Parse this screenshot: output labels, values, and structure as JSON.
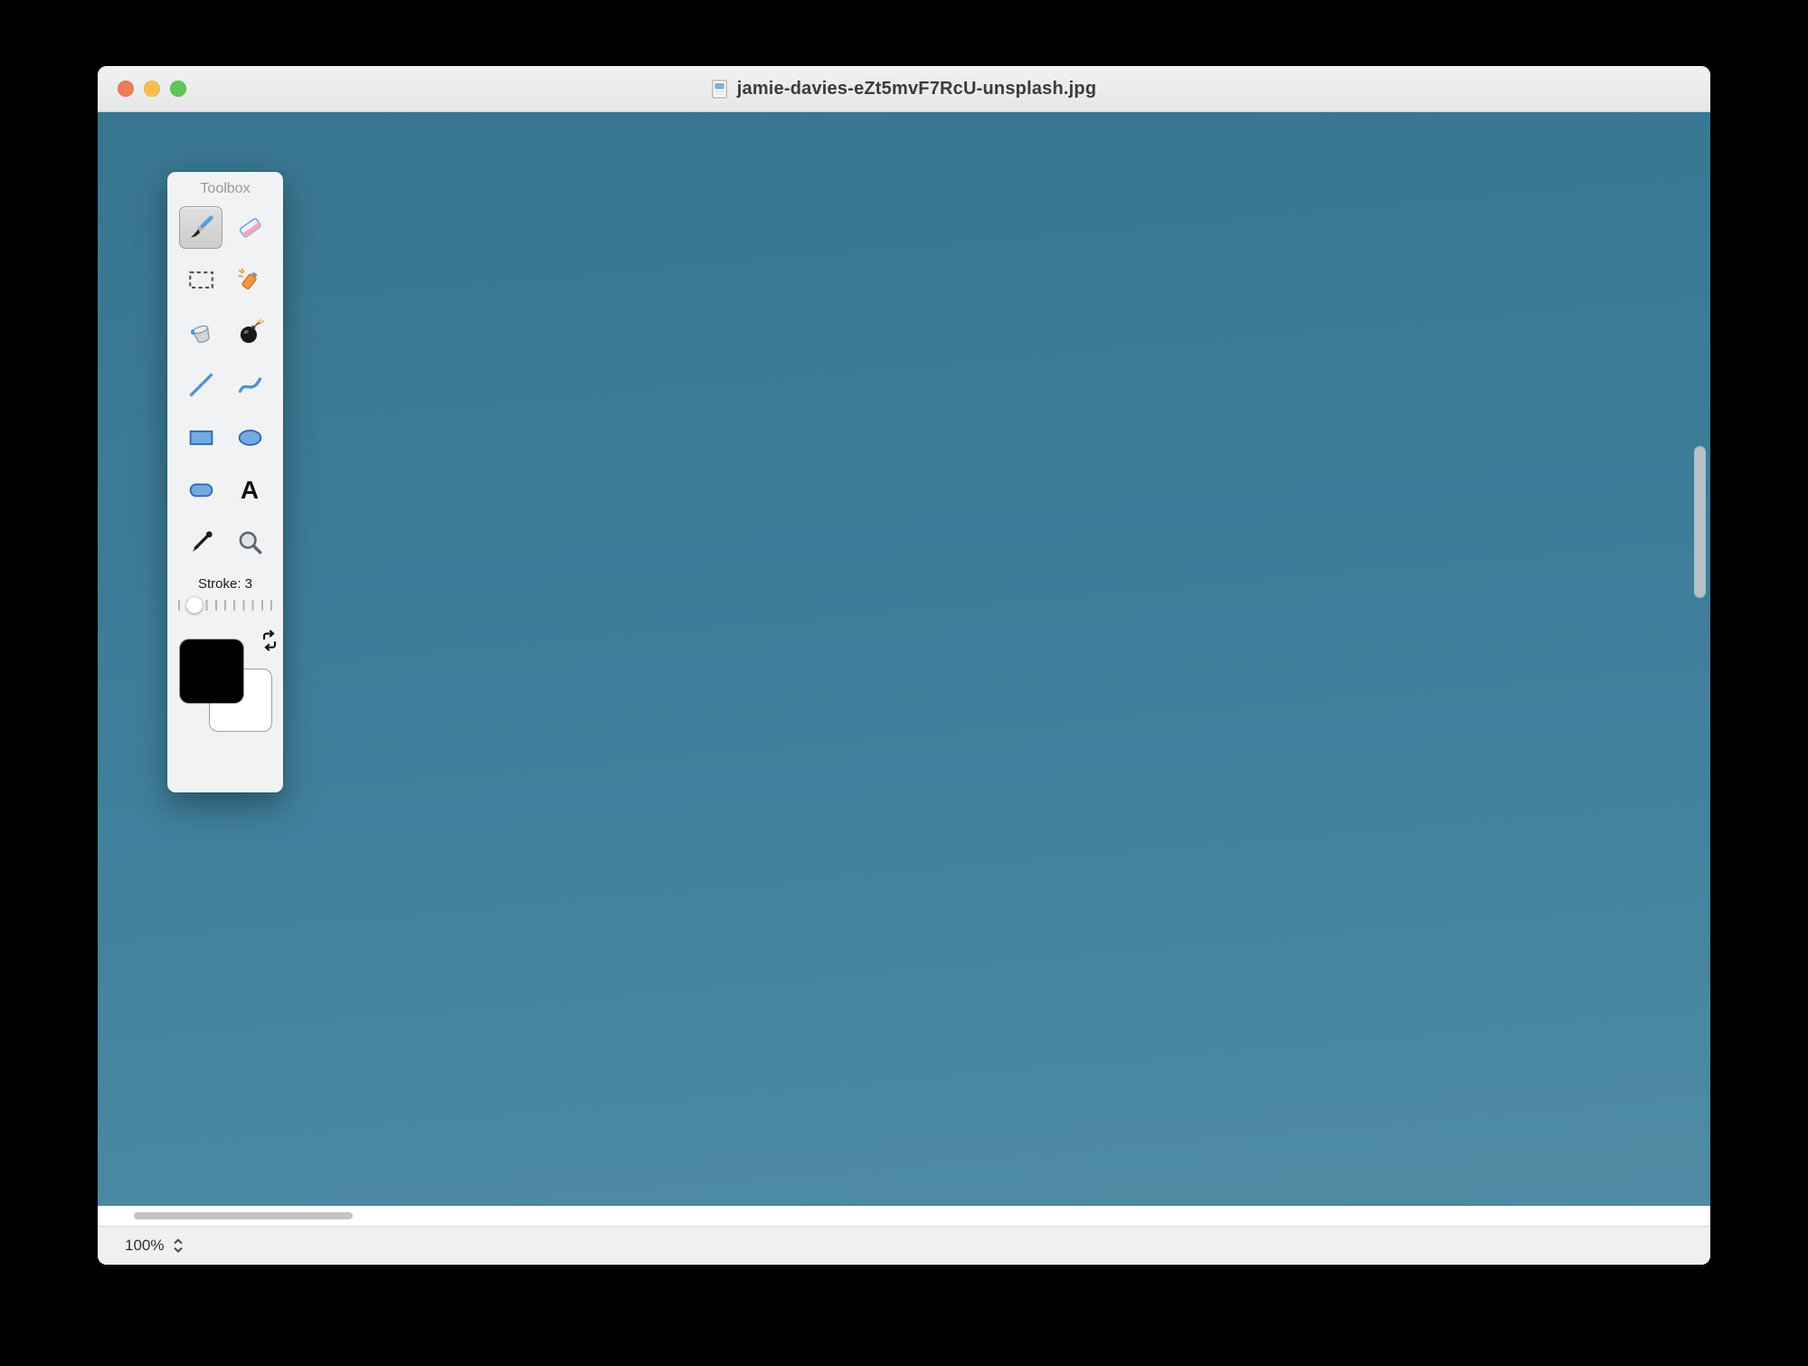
{
  "window": {
    "title": "jamie-davies-eZt5mvF7RcU-unsplash.jpg"
  },
  "titlebar": {
    "traffic_light_colors": [
      "#ee7b5a",
      "#f5bf4f",
      "#61c554"
    ]
  },
  "toolbox": {
    "title": "Toolbox",
    "selected_tool": "paintbrush",
    "tools": [
      "paintbrush",
      "eraser",
      "selection",
      "spray-can",
      "paint-bucket",
      "bomb",
      "line",
      "curve",
      "rectangle",
      "ellipse",
      "rounded-rectangle",
      "text",
      "eyedropper",
      "magnifier"
    ],
    "text_tool_glyph": "A",
    "stroke_label": "Stroke: 3",
    "stroke_value": 3,
    "foreground_color": "#000000",
    "background_color": "#ffffff"
  },
  "canvas": {
    "top_color": "#38758f",
    "mid_color": "#3f7f9b",
    "bottom_color": "#4f8ba3"
  },
  "statusbar": {
    "zoom": "100%"
  }
}
